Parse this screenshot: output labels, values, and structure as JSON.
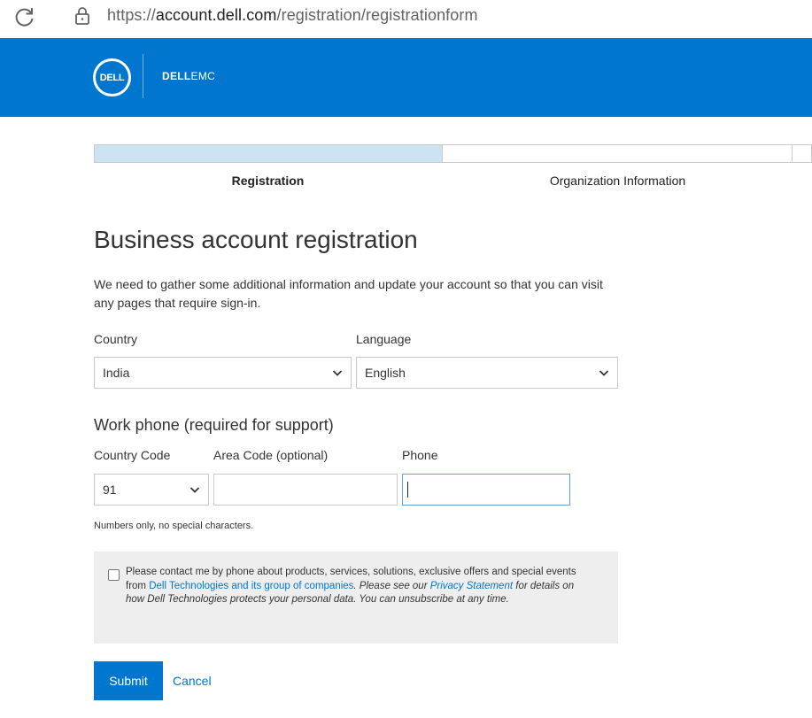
{
  "browser": {
    "url_scheme": "https://",
    "url_host": "account.dell.com",
    "url_path": "/registration/registrationform"
  },
  "header": {
    "logo_text": "DELL",
    "brand_bold": "DELL",
    "brand_light": "EMC",
    "background_color": "#0076ce"
  },
  "progress": {
    "steps": [
      {
        "label": "Registration",
        "active": true
      },
      {
        "label": "Organization Information",
        "active": false
      }
    ]
  },
  "page": {
    "title": "Business account registration",
    "intro": "We need to gather some additional information and update your account so that you can visit any pages that require sign-in."
  },
  "form": {
    "country_label": "Country",
    "country_value": "India",
    "language_label": "Language",
    "language_value": "English",
    "phone_heading": "Work phone (required for support)",
    "country_code_label": "Country Code",
    "country_code_value": "91",
    "area_code_label": "Area Code (optional)",
    "area_code_value": "",
    "phone_label": "Phone",
    "phone_value": "",
    "hint": "Numbers only, no special characters."
  },
  "consent": {
    "text_1": "Please contact me by phone about products, services, solutions, exclusive offers and special events from ",
    "link_1": "Dell Technologies and its group of companies",
    "text_2": ". Please see our ",
    "link_2": "Privacy Statement",
    "text_3": " for details on how Dell Technologies protects your personal data. You can unsubscribe at any time.",
    "checked": false
  },
  "actions": {
    "submit_label": "Submit",
    "cancel_label": "Cancel"
  }
}
